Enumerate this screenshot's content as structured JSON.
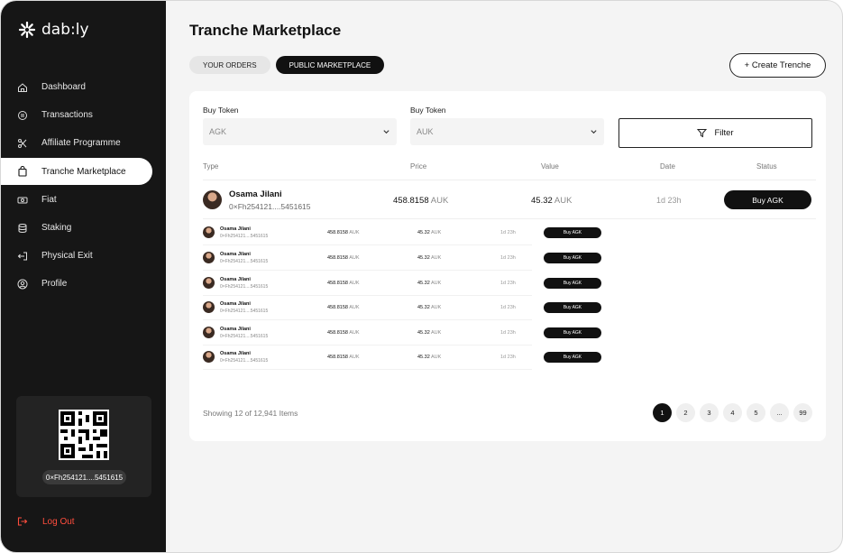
{
  "brand": {
    "name": "dab:ly"
  },
  "sidebar": {
    "items": [
      {
        "label": "Dashboard",
        "icon": "home-icon"
      },
      {
        "label": "Transactions",
        "icon": "transactions-icon"
      },
      {
        "label": "Affiliate Programme",
        "icon": "affiliate-icon"
      },
      {
        "label": "Tranche Marketplace",
        "icon": "shopping-bag-icon",
        "active": true
      },
      {
        "label": "Fiat",
        "icon": "cash-icon"
      },
      {
        "label": "Staking",
        "icon": "stack-icon"
      },
      {
        "label": "Physical Exit",
        "icon": "exit-icon"
      },
      {
        "label": "Profile",
        "icon": "user-circle-icon"
      }
    ],
    "wallet_address": "0×Fh254121....5451615",
    "logout_label": "Log Out"
  },
  "page": {
    "title": "Tranche Marketplace",
    "tabs": [
      "YOUR ORDERS",
      "PUBLIC MARKETPLACE"
    ],
    "active_tab": "PUBLIC MARKETPLACE",
    "create_button": "+ Create Trenche"
  },
  "filters": {
    "buy_token_1": {
      "label": "Buy Token",
      "value": "AGK"
    },
    "buy_token_2": {
      "label": "Buy Token",
      "value": "AUK"
    },
    "filter_label": "Filter"
  },
  "table": {
    "headers": {
      "type": "Type",
      "price": "Price",
      "value": "Value",
      "date": "Date",
      "status": "Status"
    },
    "featured": {
      "name": "Osama Jilani",
      "address": "0×Fh254121....5451615",
      "price": "458.8158",
      "price_unit": "AUK",
      "value": "45.32",
      "value_unit": "AUK",
      "date": "1d 23h",
      "action": "Buy AGK"
    },
    "rows": [
      {
        "name": "Osama Jilani",
        "address": "0×Fh254121....5451615",
        "price": "458.8158",
        "price_unit": "AUK",
        "value": "45.32",
        "value_unit": "AUK",
        "date": "1d 23h",
        "action": "Buy AGK"
      },
      {
        "name": "Osama Jilani",
        "address": "0×Fh254121....5451615",
        "price": "458.8158",
        "price_unit": "AUK",
        "value": "45.32",
        "value_unit": "AUK",
        "date": "1d 23h",
        "action": "Buy AGK"
      },
      {
        "name": "Osama Jilani",
        "address": "0×Fh254121....5451615",
        "price": "458.8158",
        "price_unit": "AUK",
        "value": "45.32",
        "value_unit": "AUK",
        "date": "1d 23h",
        "action": "Buy AGK"
      },
      {
        "name": "Osama Jilani",
        "address": "0×Fh254121....5451615",
        "price": "458.8158",
        "price_unit": "AUK",
        "value": "45.32",
        "value_unit": "AUK",
        "date": "1d 23h",
        "action": "Buy AGK"
      },
      {
        "name": "Osama Jilani",
        "address": "0×Fh254121....5451615",
        "price": "458.8158",
        "price_unit": "AUK",
        "value": "45.32",
        "value_unit": "AUK",
        "date": "1d 23h",
        "action": "Buy AGK"
      },
      {
        "name": "Osama Jilani",
        "address": "0×Fh254121....5451615",
        "price": "458.8158",
        "price_unit": "AUK",
        "value": "45.32",
        "value_unit": "AUK",
        "date": "1d 23h",
        "action": "Buy AGK"
      }
    ]
  },
  "pagination": {
    "showing": "Showing 12 of 12,941 Items",
    "pages": [
      "1",
      "2",
      "3",
      "4",
      "5",
      "...",
      "99"
    ],
    "current": "1"
  },
  "colors": {
    "sidebar_bg": "#161616",
    "accent": "#111111",
    "logout": "#ff4d3d",
    "page_bg": "#f4f4f4"
  }
}
